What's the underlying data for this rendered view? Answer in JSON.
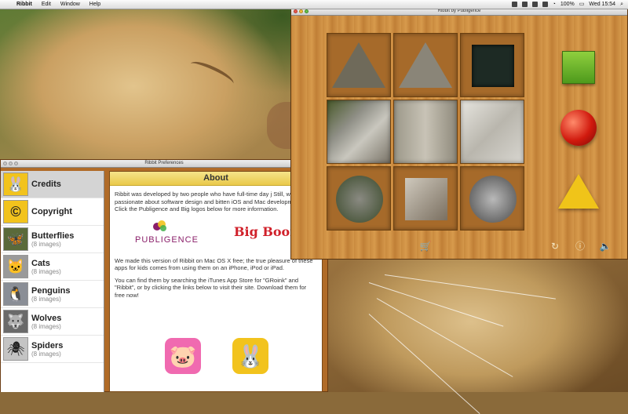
{
  "menubar": {
    "apple_icon": "apple-icon",
    "items": [
      "Ribbit",
      "Edit",
      "Window",
      "Help"
    ],
    "status": {
      "battery": "100%",
      "clock": "Wed 15:54"
    }
  },
  "prefs": {
    "title": "Ribbit Preferences",
    "categories": [
      {
        "name": "Credits",
        "sub": "",
        "icon": "bunny-face-icon",
        "glyph": "🐰",
        "color": "#f2c31d"
      },
      {
        "name": "Copyright",
        "sub": "",
        "icon": "copyright-icon",
        "glyph": "©",
        "color": "#f2c31d"
      },
      {
        "name": "Butterflies",
        "sub": "(8 images)",
        "icon": "butterfly-thumb",
        "glyph": "🦋",
        "color": "#c0392b"
      },
      {
        "name": "Cats",
        "sub": "(8 images)",
        "icon": "cat-thumb",
        "glyph": "🐱",
        "color": "#8a8a8a"
      },
      {
        "name": "Penguins",
        "sub": "(8 images)",
        "icon": "penguin-thumb",
        "glyph": "🐧",
        "color": "#667"
      },
      {
        "name": "Wolves",
        "sub": "(8 images)",
        "icon": "wolf-thumb",
        "glyph": "🐺",
        "color": "#555"
      },
      {
        "name": "Spiders",
        "sub": "(8 images)",
        "icon": "spider-thumb",
        "glyph": "🕷",
        "color": "#b9b9b9"
      }
    ],
    "about": {
      "title": "About",
      "para1": "Ribbit was developed by two people who have full-time day j Still, we're both passionate about software design and bitten iOS and Mac development virus. Click the Publigence and Big logos below for more information.",
      "publigence_label": "PUBLIGENCE",
      "bigboom_label": "Big Boom",
      "para2": "We made this version of Ribbit on Mac OS X free; the true pleasure of these apps for kids comes from using them on an iPhone, iPod or iPad.",
      "para3": "You can find them by searching the iTunes App Store for \"GRoink\" and \"Ribbit\", or by clicking the links below to visit their site. Download them for free now!",
      "apps": [
        {
          "name": "groink-app-icon",
          "glyph": "🐷",
          "color": "#f06ab0"
        },
        {
          "name": "ribbit-app-icon",
          "glyph": "🐰",
          "color": "#f2c31d"
        }
      ]
    }
  },
  "game": {
    "title": "Ribbit by Publigence",
    "controls": {
      "cart": "🛒",
      "refresh": "↻",
      "info": "ⓘ",
      "sound": "🔈"
    }
  }
}
